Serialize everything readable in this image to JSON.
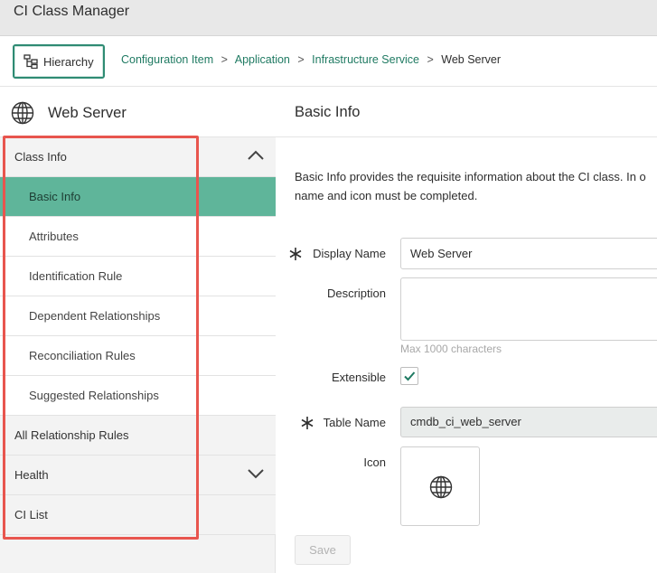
{
  "app": {
    "title": "CI Class Manager"
  },
  "toolbar": {
    "hierarchy_label": "Hierarchy"
  },
  "breadcrumb": {
    "items": [
      "Configuration Item",
      "Application",
      "Infrastructure Service"
    ],
    "separator": ">",
    "current": "Web Server"
  },
  "sidebar": {
    "class_name": "Web Server",
    "class_icon": "globe-icon",
    "sections": [
      {
        "label": "Class Info",
        "expanded": true,
        "chevron": "chevron-up-icon"
      },
      {
        "label": "All Relationship Rules"
      },
      {
        "label": "Health",
        "expanded": false,
        "chevron": "chevron-down-icon"
      },
      {
        "label": "CI List"
      }
    ],
    "class_info_items": [
      "Basic Info",
      "Attributes",
      "Identification Rule",
      "Dependent Relationships",
      "Reconciliation Rules",
      "Suggested Relationships"
    ],
    "active_item": "Basic Info"
  },
  "main": {
    "title": "Basic Info",
    "intro_line1": "Basic Info provides the requisite information about the CI class. In o",
    "intro_line2": "name and icon must be completed.",
    "fields": {
      "display_name": {
        "label": "Display Name",
        "value": "Web Server",
        "required": true
      },
      "description": {
        "label": "Description",
        "value": "",
        "hint": "Max 1000 characters"
      },
      "extensible": {
        "label": "Extensible",
        "checked": true
      },
      "table_name": {
        "label": "Table Name",
        "value": "cmdb_ci_web_server",
        "required": true,
        "readonly": true
      },
      "icon": {
        "label": "Icon",
        "value": "globe-icon"
      }
    },
    "save_label": "Save"
  },
  "colors": {
    "accent": "#1f7a62",
    "active_nav": "#5fb59a",
    "highlight_border": "#e8554e",
    "title_bar": "#e8e8e8"
  }
}
